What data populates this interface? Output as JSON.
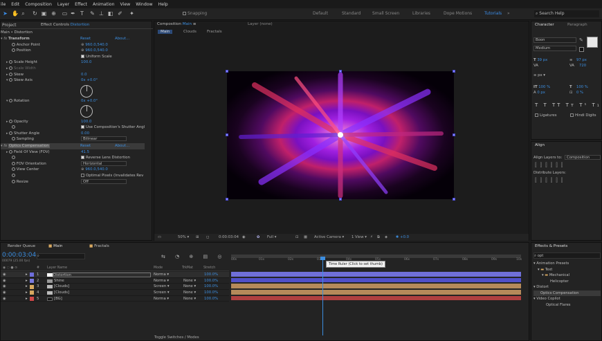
{
  "menu": [
    "ile",
    "Edit",
    "Composition",
    "Layer",
    "Effect",
    "Animation",
    "View",
    "Window",
    "Help"
  ],
  "toolbar": {
    "snapping": "Snapping",
    "workspaces": [
      "Default",
      "Standard",
      "Small Screen",
      "Libraries",
      "Dope Motions",
      "Tutorials"
    ],
    "active_workspace": "Tutorials",
    "search_placeholder": "Search Help"
  },
  "project": {
    "tab": "Project",
    "effect_controls_tab": "Effect Controls",
    "effect_controls_layer": "Distortion",
    "header": "Main • Distortion"
  },
  "effects": {
    "transform": {
      "name": "Transform",
      "reset": "Reset",
      "about": "About...",
      "anchor": "Anchor Point",
      "anchor_val": "960.0,540.0",
      "position": "Position",
      "position_val": "960.0,540.0",
      "uniform": "Uniform Scale",
      "scale_h": "Scale Height",
      "scale_h_val": "100.0",
      "scale_w": "Scale Width",
      "skew": "Skew",
      "skew_val": "0.0",
      "skew_axis": "Skew Axis",
      "skew_axis_val": "0x +0.0°",
      "rotation": "Rotation",
      "rotation_val": "0x +0.0°",
      "opacity": "Opacity",
      "opacity_val": "100.0",
      "use_shutter": "Use Composition's Shutter Angl",
      "shutter": "Shutter Angle",
      "shutter_val": "0.00",
      "sampling": "Sampling",
      "sampling_val": "Bilinear"
    },
    "optics": {
      "name": "Optics Compensation",
      "reset": "Reset",
      "about": "About...",
      "fov": "Field Of View (FOV)",
      "fov_val": "41.5",
      "reverse": "Reverse Lens Distortion",
      "fov_orient": "FOV Orientation",
      "fov_orient_val": "Horizontal",
      "view_center": "View Center",
      "view_center_val": "960.0,540.0",
      "optimal": "Optimal Pixels (Invalidates Rev",
      "resize": "Resize",
      "resize_val": "Off"
    }
  },
  "composition": {
    "tab": "Composition",
    "comp_name": "Main",
    "layer_tab": "Layer (none)",
    "breadcrumbs": [
      "Main",
      "Clouds",
      "Fractals"
    ],
    "zoom": "50%",
    "timecode": "0:00:03:04",
    "resolution": "Full",
    "camera": "Active Camera",
    "view": "1 View",
    "exposure": "+0.0"
  },
  "character": {
    "tab": "Character",
    "paragraph_tab": "Paragraph",
    "font": "Boon",
    "style": "Medium",
    "size": "39 px",
    "leading": "97 px",
    "tracking": "720",
    "unit": "px",
    "vscale": "100 %",
    "hscale": "100 %",
    "baseline": "0 px",
    "tsume": "0 %",
    "ligatures": "Ligatures",
    "hindi": "Hindi Digits"
  },
  "align": {
    "tab": "Align",
    "align_to_label": "Align Layers to:",
    "align_to": "Composition",
    "distribute": "Distribute Layers:"
  },
  "timeline": {
    "render_tab": "Render Queue",
    "main_tab": "Main",
    "fractals_tab": "Fractals",
    "timecode": "0:00:03:04",
    "fps": "00079 (25.00 fps)",
    "search_placeholder": "",
    "columns": {
      "num": "#",
      "layer_name": "Layer Name",
      "mode": "Mode",
      "trkmat": "TrkMat",
      "stretch": "Stretch"
    },
    "ruler": [
      "00s",
      "01s",
      "02s",
      "03s",
      "04s",
      "05s",
      "06s",
      "07s",
      "08s",
      "09s",
      "10s"
    ],
    "tooltip": "Time Ruler (Click to set thumb)",
    "layers": [
      {
        "num": "1",
        "name": "Distortion",
        "mode": "Norma",
        "trk": "",
        "stretch": "100.0%",
        "color": "#6e6edc",
        "bar": "#7070d8"
      },
      {
        "num": "2",
        "name": "Shine",
        "mode": "Norma",
        "trk": "None",
        "stretch": "100.0%",
        "color": "#7a7ae0",
        "bar": "#5050c8"
      },
      {
        "num": "3",
        "name": "[Clouds]",
        "mode": "Screen",
        "trk": "None",
        "stretch": "100.0%",
        "color": "#d7a860",
        "bar": "#b58a5a"
      },
      {
        "num": "4",
        "name": "[Clouds]",
        "mode": "Screen",
        "trk": "None",
        "stretch": "100.0%",
        "color": "#d7a860",
        "bar": "#b58a5a"
      },
      {
        "num": "5",
        "name": "[BG]",
        "mode": "Norma",
        "trk": "None",
        "stretch": "100.0%",
        "color": "#d04848",
        "bar": "#b04040"
      }
    ],
    "toggle": "Toggle Switches / Modes"
  },
  "effects_presets": {
    "tab": "Effects & Presets",
    "search": "opt",
    "items": [
      "Animation Presets",
      "Text",
      "Mechanical",
      "Helicopter",
      "Distort",
      "Optics Compensation",
      "Video Copilot",
      "Optical Flares"
    ]
  }
}
